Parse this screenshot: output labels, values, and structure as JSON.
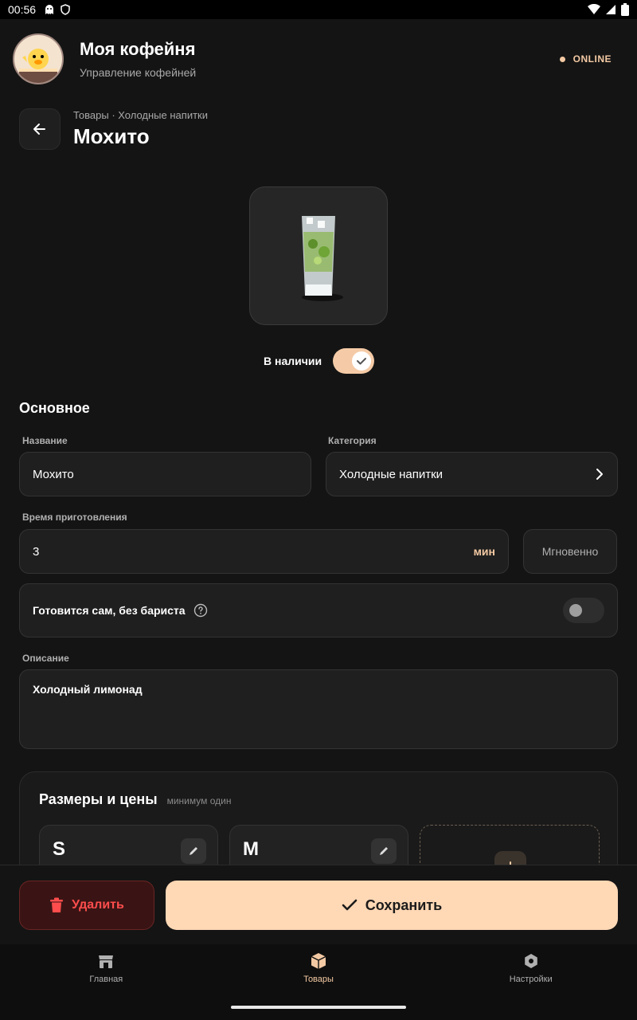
{
  "status_bar": {
    "time": "00:56",
    "icons_left": [
      "ghost-icon",
      "shield-icon"
    ],
    "icons_right": [
      "wifi-icon",
      "signal-icon",
      "battery-icon"
    ]
  },
  "app": {
    "title": "Моя кофейня",
    "subtitle": "Управление кофейней",
    "status": "ONLINE",
    "status_color": "#f3c9a3"
  },
  "header": {
    "breadcrumb": "Товары · Холодные напитки",
    "title": "Мохито"
  },
  "product": {
    "image_icon": "mojito-glass",
    "availability_label": "В наличии",
    "available": true
  },
  "form": {
    "section_title": "Основное",
    "name_label": "Название",
    "name_value": "Мохито",
    "category_label": "Категория",
    "category_value": "Холодные напитки",
    "prep_time_label": "Время приготовления",
    "prep_time_value": "3",
    "prep_time_unit": "мин",
    "instant_button": "Мгновенно",
    "self_prep_label": "Готовится сам, без бариста",
    "self_prep_enabled": false,
    "description_label": "Описание",
    "description_value": "Холодный лимонад"
  },
  "sizes": {
    "title": "Размеры и цены",
    "subtitle": "минимум один",
    "items": [
      {
        "label": "S"
      },
      {
        "label": "M"
      }
    ]
  },
  "actions": {
    "delete_label": "Удалить",
    "save_label": "Сохранить",
    "delete_color": "#ff4d4d",
    "save_color": "#ffd8b5"
  },
  "nav": {
    "items": [
      {
        "label": "Главная",
        "icon": "store-icon",
        "active": false
      },
      {
        "label": "Товары",
        "icon": "box-icon",
        "active": true
      },
      {
        "label": "Настройки",
        "icon": "gear-icon",
        "active": false
      }
    ]
  }
}
